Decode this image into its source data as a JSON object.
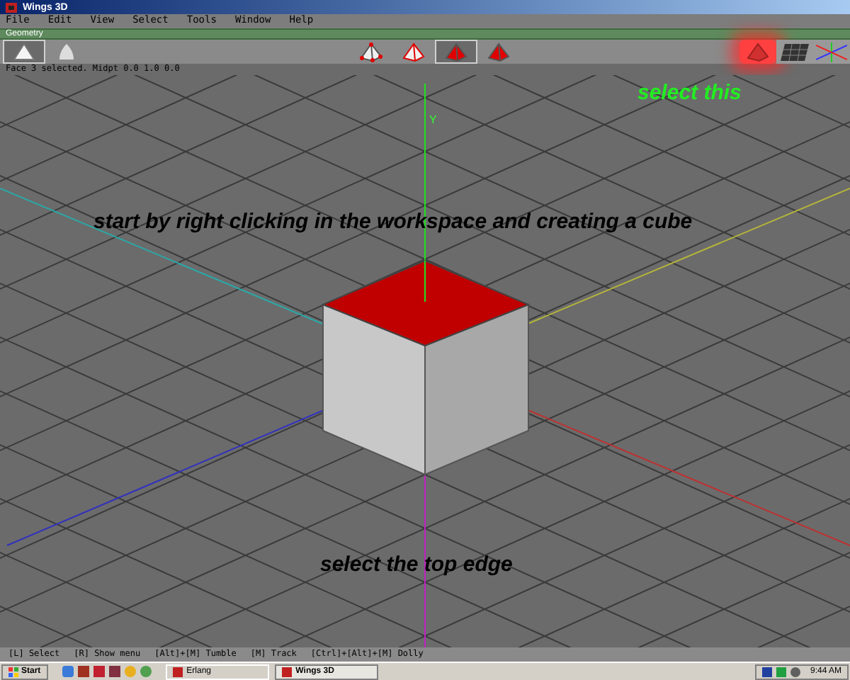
{
  "window": {
    "title": "Wings 3D"
  },
  "menu": [
    "File",
    "Edit",
    "View",
    "Select",
    "Tools",
    "Window",
    "Help"
  ],
  "panel": {
    "title": "Geometry"
  },
  "toolbar": {
    "left": [
      {
        "kind": "cube",
        "selected": true
      },
      {
        "kind": "smooth",
        "selected": false
      }
    ],
    "modes": [
      {
        "kind": "vertex",
        "selected": false
      },
      {
        "kind": "edge",
        "selected": false
      },
      {
        "kind": "face",
        "selected": true
      },
      {
        "kind": "body",
        "selected": false
      }
    ],
    "right": [
      {
        "kind": "shade",
        "selected": true
      },
      {
        "kind": "groundplane",
        "selected": false
      },
      {
        "kind": "axes",
        "selected": false
      }
    ]
  },
  "info": "Face 3 selected. Midpt 0.0 1.0 0.0",
  "viewport": {
    "axis_label": "Y",
    "annotations": [
      {
        "text": "select this",
        "color": "#22ee22"
      },
      {
        "text": "start by right clicking in the workspace and creating a cube",
        "color": "#000000"
      },
      {
        "text": "select the top edge",
        "color": "#000000"
      }
    ]
  },
  "status_bar": [
    "[L] Select",
    "[R] Show menu",
    "[Alt]+[M] Tumble",
    "[M] Track",
    "[Ctrl]+[Alt]+[M] Dolly"
  ],
  "taskbar": {
    "start": "Start",
    "tasks": [
      {
        "label": "Erlang",
        "selected": false
      },
      {
        "label": "Wings 3D",
        "selected": true
      }
    ],
    "clock": "9:44 AM"
  }
}
